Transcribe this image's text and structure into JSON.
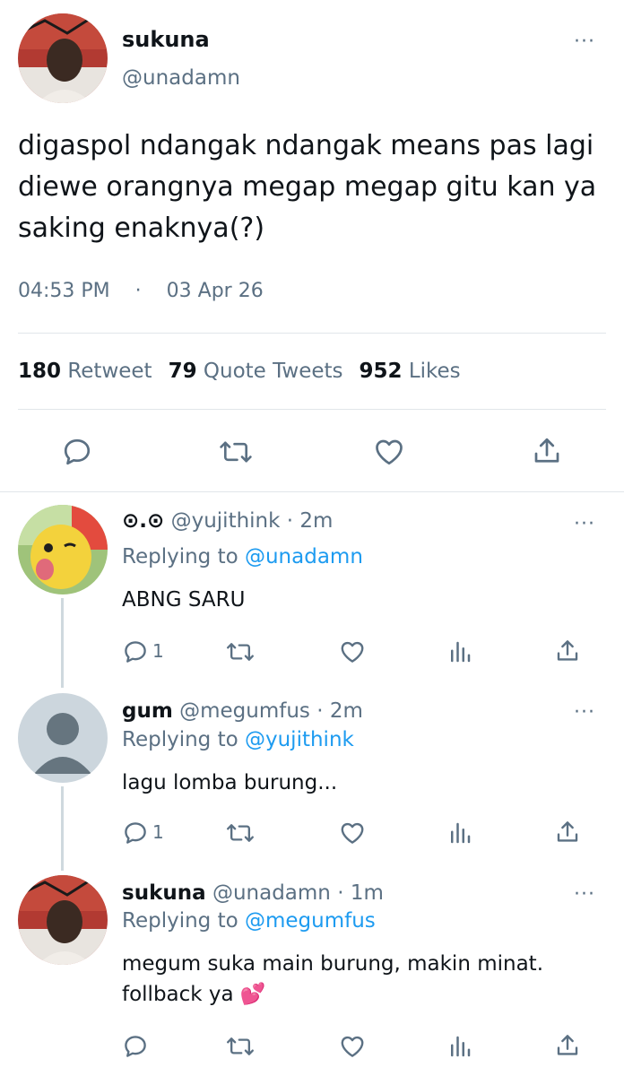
{
  "main_tweet": {
    "name": "sukuna",
    "handle": "@unadamn",
    "text": "digaspol ndangak ndangak means pas lagi diewe orangnya megap megap gitu kan ya saking enaknya(?)",
    "time": "04:53 PM",
    "separator": "·",
    "date": "03 Apr 26",
    "stats": {
      "retweets_count": "180",
      "retweets_label": "Retweet",
      "quotes_count": "79",
      "quotes_label": "Quote Tweets",
      "likes_count": "952",
      "likes_label": "Likes"
    }
  },
  "replies": [
    {
      "name": "⊙.⊙",
      "handle": "@yujithink",
      "time": "· 2m",
      "replying_label": "Replying to",
      "replying_to": "@unadamn",
      "text": "ABNG SARU",
      "reply_count": "1"
    },
    {
      "name": "gum",
      "handle": "@megumfus",
      "time": "· 2m",
      "replying_label": "Replying to",
      "replying_to": "@yujithink",
      "text": "lagu lomba burung...",
      "reply_count": "1"
    },
    {
      "name": "sukuna",
      "handle": "@unadamn",
      "time": "· 1m",
      "replying_label": "Replying to",
      "replying_to": "@megumfus",
      "text": "megum suka main burung, makin minat. follback ya 💕",
      "reply_count": ""
    }
  ],
  "more_icon": "···",
  "colors": {
    "text": "#0f1419",
    "secondary": "#5b7083",
    "link": "#1d9bf0",
    "divider": "#e1e6ea"
  }
}
